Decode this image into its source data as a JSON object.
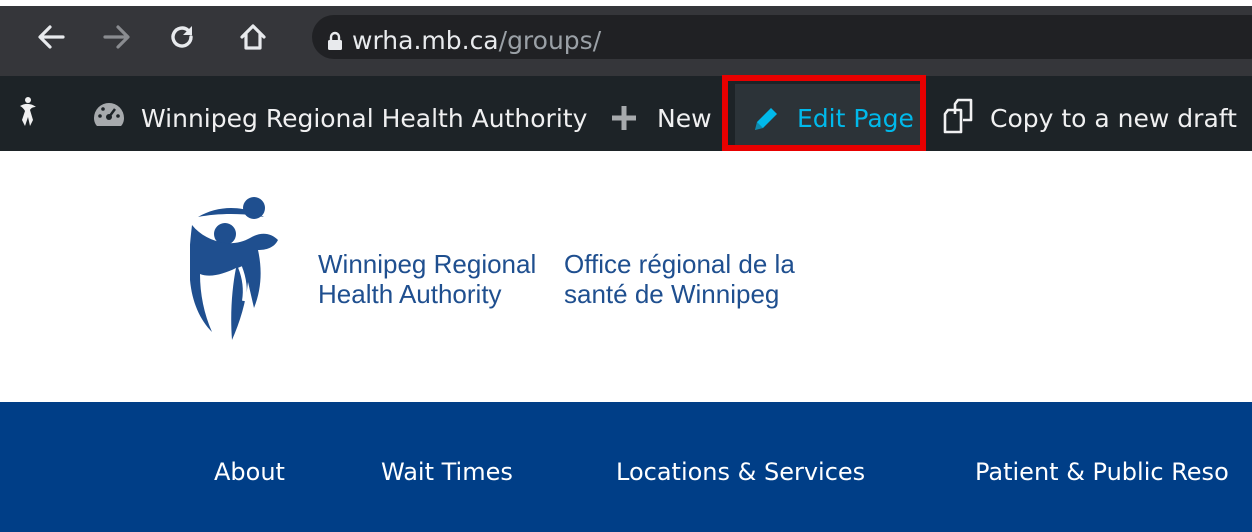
{
  "browser": {
    "url_host": "wrha.mb.ca",
    "url_path": "/groups/",
    "buttons": [
      "back",
      "forward",
      "reload",
      "home"
    ]
  },
  "admin_bar": {
    "site_name": "Winnipeg Regional Health Authority",
    "new_label": "New",
    "edit_label": "Edit Page",
    "copy_label": "Copy to a new draft"
  },
  "logo": {
    "en_line1": "Winnipeg Regional",
    "en_line2": "Health Authority",
    "fr_line1": "Office régional de la",
    "fr_line2": "santé de Winnipeg"
  },
  "site_nav": {
    "items": [
      {
        "label": "About"
      },
      {
        "label": "Wait Times"
      },
      {
        "label": "Locations & Services"
      },
      {
        "label": "Patient & Public Reso"
      }
    ]
  },
  "colors": {
    "chrome_bg": "#35363a",
    "adminbar_bg": "#1d2327",
    "edit_accent": "#00b9eb",
    "nav_bg": "#003e87",
    "highlight": "#e80000"
  }
}
